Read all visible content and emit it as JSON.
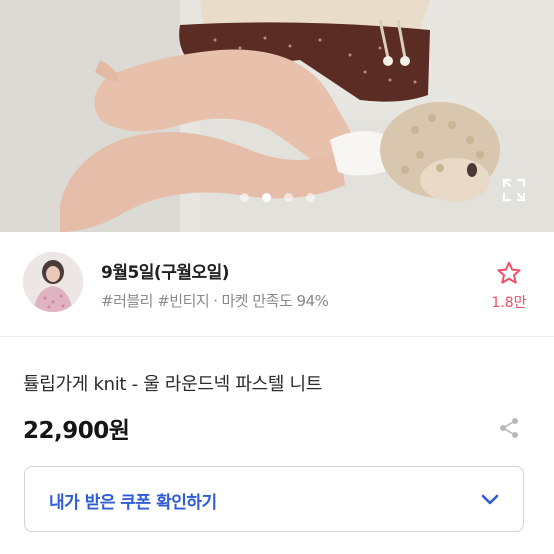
{
  "gallery": {
    "image_count": 4,
    "active_index": 1
  },
  "seller": {
    "name": "9월5일(구월오일)",
    "tags": "#러블리 #빈티지",
    "separator": "·",
    "satisfaction": "마켓 만족도 94%",
    "favorite_count": "1.8만"
  },
  "product": {
    "title": "튤립가게 knit - 울 라운드넥 파스텔 니트",
    "price": "22,900원"
  },
  "coupon": {
    "label": "내가 받은 쿠폰 확인하기"
  },
  "colors": {
    "accent_blue": "#2e5cd6",
    "favorite_red": "#ef4f66",
    "meta_gray": "#8a8a8a"
  },
  "icons": {
    "expand": "expand-icon",
    "favorite": "star-outline-icon",
    "share": "share-icon",
    "chevron": "chevron-down-icon"
  }
}
